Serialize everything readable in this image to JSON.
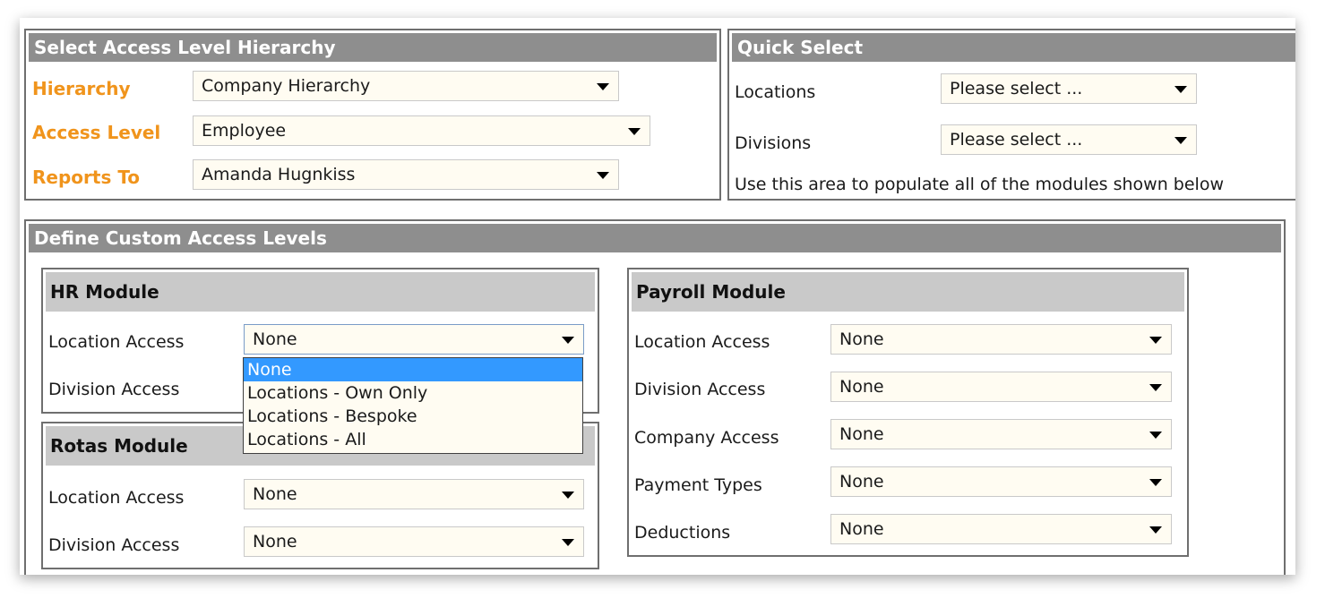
{
  "access_hierarchy": {
    "title": "Select Access Level Hierarchy",
    "hierarchy_label": "Hierarchy",
    "hierarchy_value": "Company Hierarchy",
    "access_level_label": "Access Level",
    "access_level_value": "Employee",
    "reports_to_label": "Reports To",
    "reports_to_value": "Amanda Hugnkiss"
  },
  "quick_select": {
    "title": "Quick Select",
    "locations_label": "Locations",
    "locations_value": "Please select ...",
    "divisions_label": "Divisions",
    "divisions_value": "Please select ...",
    "hint": "Use this area to populate all of the modules shown below"
  },
  "custom_access": {
    "title": "Define Custom Access Levels"
  },
  "hr_module": {
    "title": "HR Module",
    "location_label": "Location Access",
    "location_value": "None",
    "division_label": "Division Access",
    "dropdown_options": [
      "None",
      "Locations - Own Only",
      "Locations - Bespoke",
      "Locations - All"
    ]
  },
  "rotas_module": {
    "title": "Rotas Module",
    "location_label": "Location Access",
    "location_value": "None",
    "division_label": "Division Access",
    "division_value": "None"
  },
  "payroll_module": {
    "title": "Payroll Module",
    "location_label": "Location Access",
    "location_value": "None",
    "division_label": "Division Access",
    "division_value": "None",
    "company_label": "Company Access",
    "company_value": "None",
    "payment_label": "Payment Types",
    "payment_value": "None",
    "deductions_label": "Deductions",
    "deductions_value": "None"
  },
  "colors": {
    "header_bg": "#8e8e8e",
    "module_header_bg": "#c9c9c9",
    "label_orange": "#f0941c",
    "select_bg": "#fffcf2",
    "highlight": "#3399ff"
  }
}
